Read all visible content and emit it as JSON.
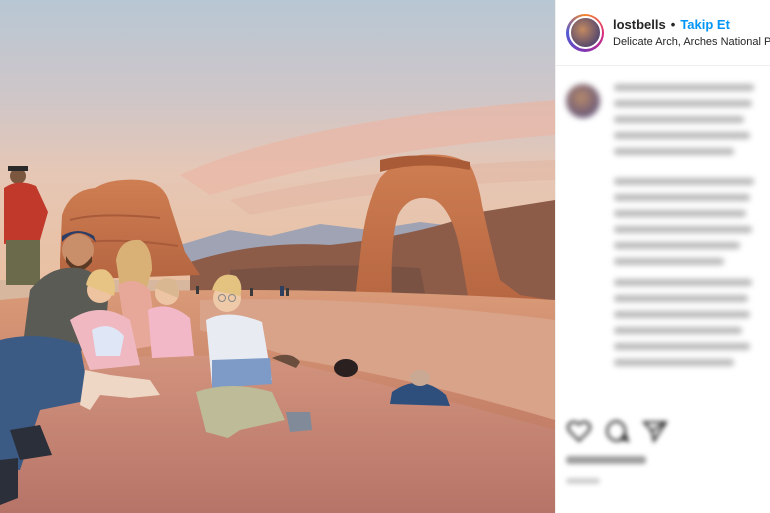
{
  "post": {
    "username": "lostbells",
    "separator": "•",
    "follow_label": "Takip Et",
    "location": "Delicate Arch, Arches National Park"
  },
  "photo": {
    "subject": "family-at-delicate-arch"
  },
  "icons": {
    "like": "heart-icon",
    "comment": "comment-icon",
    "share": "share-icon"
  },
  "colors": {
    "follow_blue": "#0095f6",
    "text": "#262626",
    "divider": "#efefef"
  }
}
